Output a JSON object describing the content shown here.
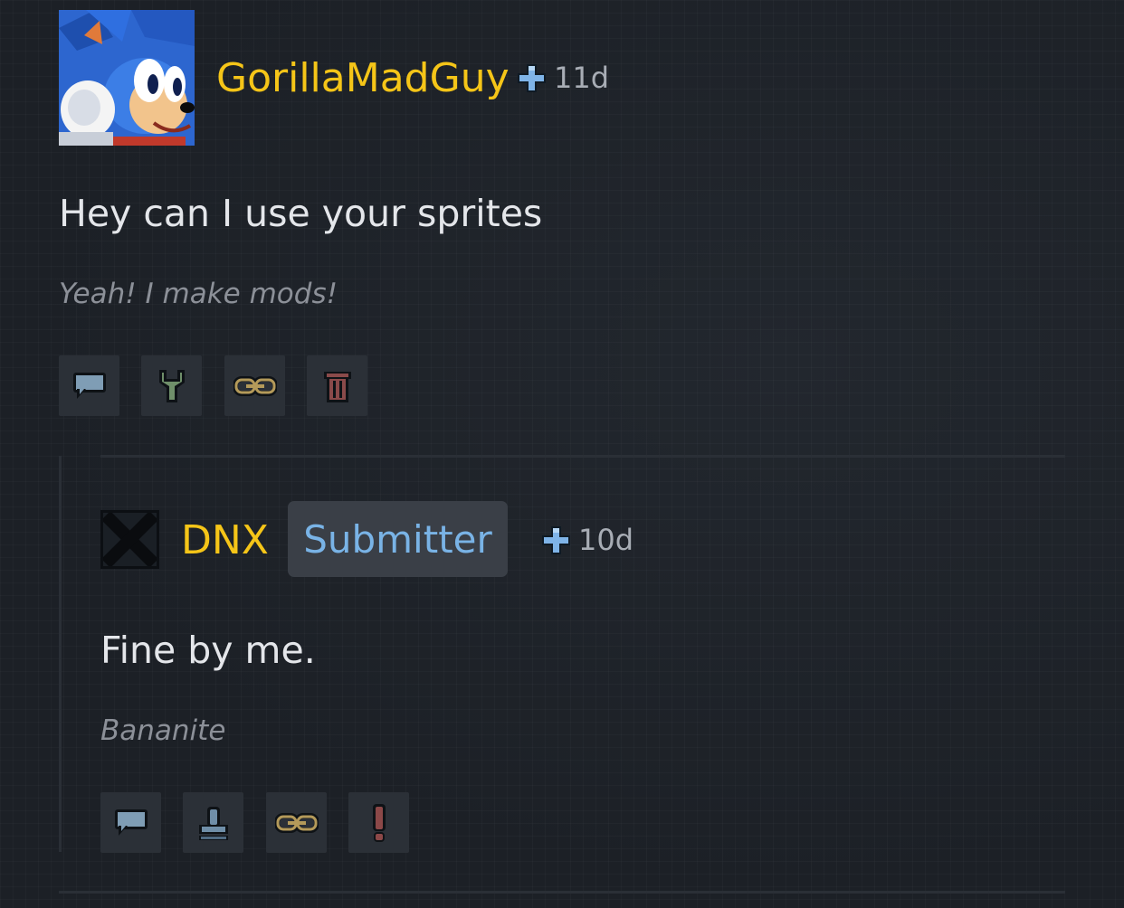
{
  "comment": {
    "username": "GorillaMadGuy",
    "time": "11d",
    "text": "Hey can I use your sprites",
    "signature": "Yeah! I make mods!",
    "actions": [
      "reply-icon",
      "wrench-icon",
      "link-icon",
      "trash-icon"
    ]
  },
  "reply": {
    "username": "DNX",
    "badge": "Submitter",
    "time": "10d",
    "text": "Fine by me.",
    "signature": "Bananite",
    "actions": [
      "reply-icon",
      "stamp-icon",
      "link-icon",
      "report-icon"
    ]
  },
  "colors": {
    "background": "#1f2329",
    "username": "#f5c518",
    "badge_text": "#79b3e6",
    "text": "#e4e6ea",
    "muted": "#8c9098"
  }
}
